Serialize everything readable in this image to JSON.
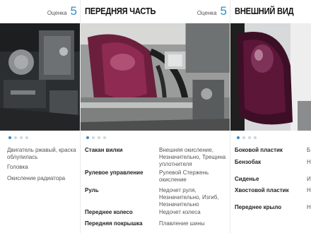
{
  "left_card": {
    "score_label": "Оценка",
    "score_value": "5",
    "specs": [
      {
        "value": "Двигатель ржавый, краска облупилась"
      },
      {
        "value": "Головка"
      },
      {
        "value": "Окисление радиатора"
      }
    ]
  },
  "middle_card": {
    "title": "ПЕРЕДНЯЯ ЧАСТЬ",
    "score_label": "Оценка",
    "score_value": "5",
    "specs": [
      {
        "label": "Стакан вилки",
        "value": "Внешняя окисление, Незначительно, Трещина уплотнителя"
      },
      {
        "label": "Рулевое управление",
        "value": "Рулевой Стержень окисление"
      },
      {
        "label": "Руль",
        "value": "Недочет руля, Незначительно, Изгиб, Незначительно"
      },
      {
        "label": "Переднее колесо",
        "value": "Недочет колеса"
      },
      {
        "label": "Передняя покрышка",
        "value": "Плавление шины"
      }
    ]
  },
  "right_card": {
    "title": "ВНЕШНИЙ ВИД",
    "specs": [
      {
        "label": "Боковой пластик",
        "value": "Б"
      },
      {
        "label": "Бензобак",
        "value": "Н"
      },
      {
        "label": "Сиденье",
        "value": "И"
      },
      {
        "label": "Хвостовой пластик",
        "value": "Н"
      },
      {
        "label": "Переднее крыло",
        "value": "Н"
      }
    ]
  },
  "colors": {
    "accent": "#2f8fc1",
    "dot_active": "#3d8bbd",
    "dot_inactive": "#cfd6dc"
  }
}
